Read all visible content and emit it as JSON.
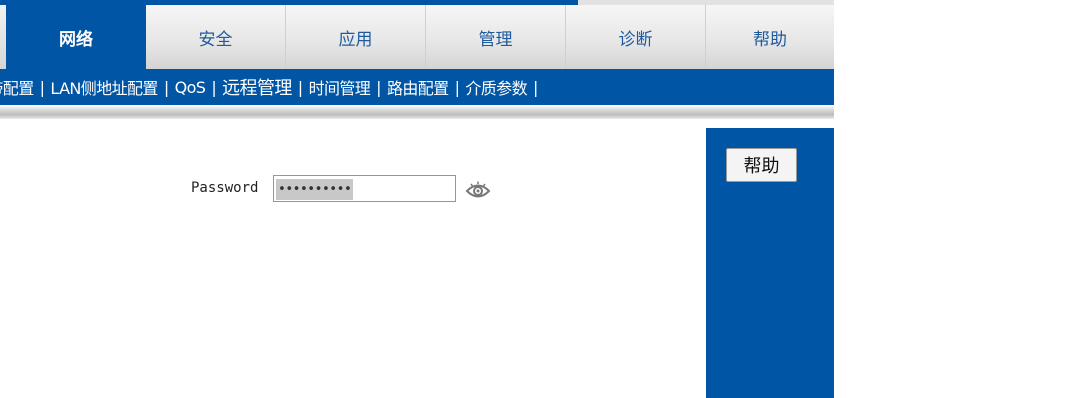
{
  "tabs": [
    {
      "label": "网络",
      "active": true
    },
    {
      "label": "安全",
      "active": false
    },
    {
      "label": "应用",
      "active": false
    },
    {
      "label": "管理",
      "active": false
    },
    {
      "label": "诊断",
      "active": false
    },
    {
      "label": "帮助",
      "active": false
    }
  ],
  "submenu": {
    "items": [
      {
        "label": "宽带配置"
      },
      {
        "label": "LAN侧地址配置"
      },
      {
        "label": "QoS"
      },
      {
        "label": "远程管理",
        "active": true
      },
      {
        "label": "时间管理"
      },
      {
        "label": "路由配置"
      },
      {
        "label": "介质参数"
      }
    ],
    "separator": "|"
  },
  "form": {
    "password_label": "Password",
    "password_mask": "••••••••••"
  },
  "help_panel": {
    "button_label": "帮助"
  },
  "colors": {
    "brand_blue": "#0055a5",
    "tab_text": "#1e5a9e"
  },
  "icons": {
    "password_toggle": "eye-icon"
  }
}
